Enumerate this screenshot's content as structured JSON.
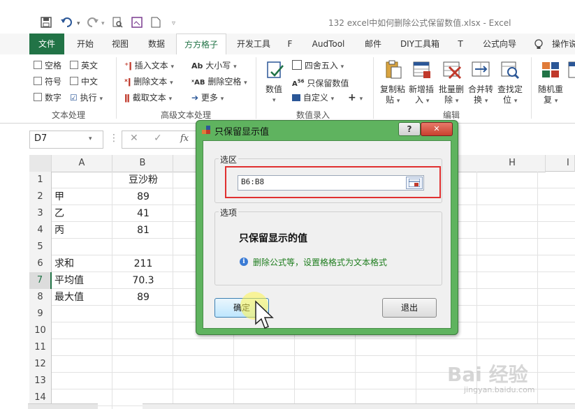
{
  "title_bar": {
    "window_title": "132 excel中如何删除公式保留数值.xlsx  -  Excel"
  },
  "ribbon_tabs": [
    {
      "label": "文件"
    },
    {
      "label": "开始"
    },
    {
      "label": "视图"
    },
    {
      "label": "数据"
    },
    {
      "label": "方方格子"
    },
    {
      "label": "开发工具"
    },
    {
      "label": "F"
    },
    {
      "label": "AudTool"
    },
    {
      "label": "邮件"
    },
    {
      "label": "DIY工具箱"
    },
    {
      "label": "T"
    },
    {
      "label": "公式向导"
    },
    {
      "label": "操作说"
    }
  ],
  "ribbon": {
    "text_processing": {
      "checkboxes": [
        "空格",
        "英文",
        "符号",
        "中文",
        "数字"
      ],
      "execute": "执行",
      "group_label": "文本处理"
    },
    "advanced_text": {
      "insert_text": "插入文本",
      "delete_text": "删除文本",
      "cut_text": "截取文本",
      "case": "大小写",
      "delete_spaces": "删除空格",
      "more": "更多",
      "group_label": "高级文本处理"
    },
    "data_entry": {
      "value": "数值",
      "round": "四舍五入",
      "keep_values": "只保留数值",
      "custom": "自定义",
      "plus": "+",
      "group_label": "数值录入"
    },
    "edit": {
      "copy_paste": [
        "复制粘",
        "贴"
      ],
      "add_insert": [
        "新增插",
        "入"
      ],
      "batch_delete": [
        "批量删",
        "除"
      ],
      "merge_convert": [
        "合并转",
        "换"
      ],
      "find_locate": [
        "查找定",
        "位"
      ],
      "random": [
        "随机重",
        "复"
      ],
      "group_label": "编辑"
    }
  },
  "formula_bar": {
    "name_box": "D7",
    "fx": "fx"
  },
  "grid": {
    "columns": [
      "A",
      "B",
      "H",
      "I"
    ],
    "rows": [
      "1",
      "2",
      "3",
      "4",
      "5",
      "6",
      "7",
      "8",
      "9",
      "10",
      "11",
      "12",
      "13",
      "14"
    ],
    "cells": {
      "B1": "豆沙粉",
      "A2": "甲",
      "B2": "89",
      "A3": "乙",
      "B3": "41",
      "A4": "丙",
      "B4": "81",
      "A6": "求和",
      "B6": "211",
      "A7": "平均值",
      "B7": "70.3",
      "A8": "最大值",
      "B8": "89"
    }
  },
  "dialog": {
    "title": "只保留显示值",
    "selection_legend": "选区",
    "range_value": "B6:B8",
    "options_legend": "选项",
    "option_title": "只保留显示的值",
    "option_hint": "删除公式等，设置格格式为文本格式",
    "ok_label": "确定",
    "exit_label": "退出",
    "help_glyph": "?",
    "close_glyph": "✕"
  },
  "colors": {
    "excel_green": "#217346",
    "dialog_green": "#5fb35f",
    "highlight_red": "#e03030",
    "hint_green": "#1e7d1e"
  },
  "watermark": {
    "brand": "Bai 经验",
    "url": "jingyan.baidu.com"
  }
}
